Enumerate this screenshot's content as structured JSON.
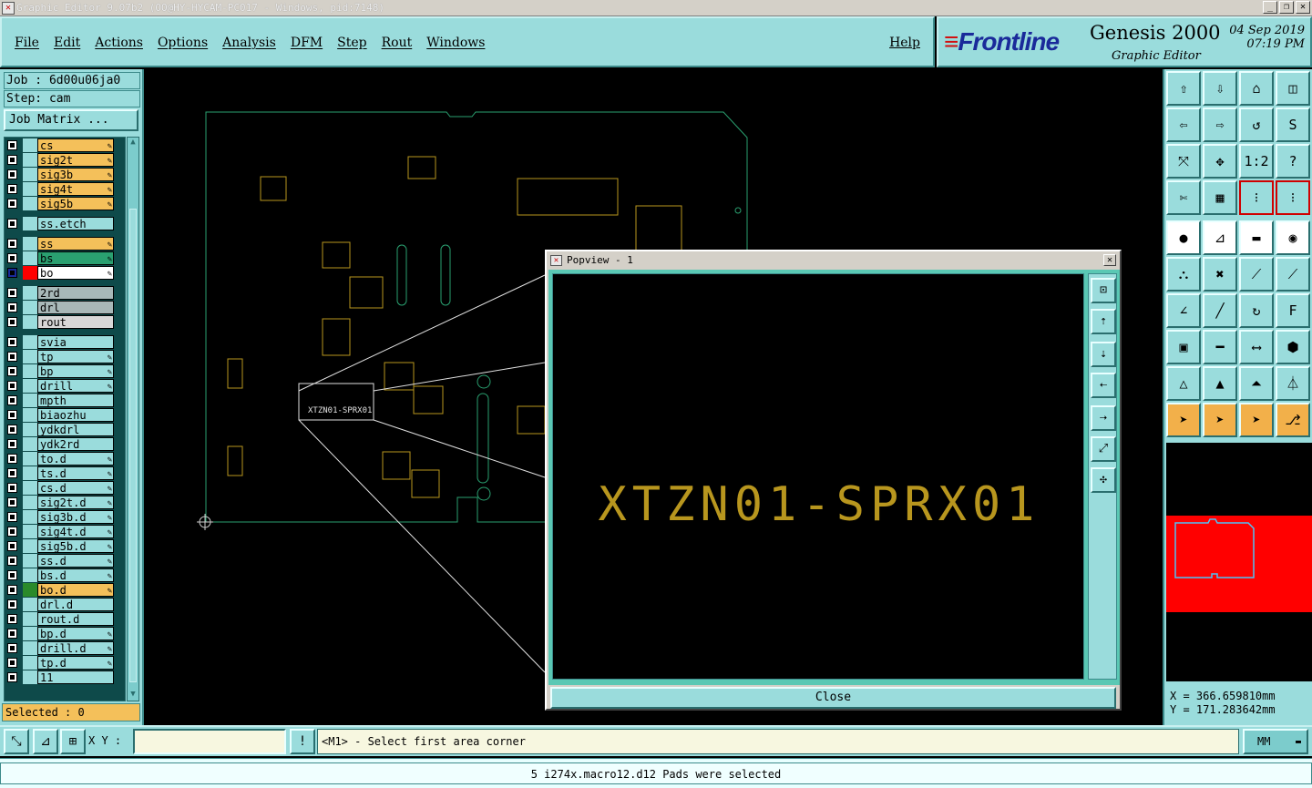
{
  "window": {
    "title": "Graphic Editor 9.07b2 (OO@HY-HYCAM-PC017 - Windows, pid:7148)"
  },
  "menu": {
    "items": [
      "File",
      "Edit",
      "Actions",
      "Options",
      "Analysis",
      "DFM",
      "Step",
      "Rout",
      "Windows"
    ],
    "help": "Help"
  },
  "brand": {
    "logo": "Frontline",
    "product": "Genesis 2000",
    "subtitle": "Graphic Editor",
    "date": "04 Sep 2019",
    "time": "07:19 PM"
  },
  "job": {
    "job_label": "Job : 6d00u06ja0",
    "step_label": "Step: cam",
    "matrix_button": "Job Matrix ..."
  },
  "layers": [
    {
      "name": "cs",
      "color": "#f4c05a",
      "editable": true
    },
    {
      "name": "sig2t",
      "color": "#f4c05a",
      "editable": true
    },
    {
      "name": "sig3b",
      "color": "#f4c05a",
      "editable": true
    },
    {
      "name": "sig4t",
      "color": "#f4c05a",
      "editable": true
    },
    {
      "name": "sig5b",
      "color": "#f4c05a",
      "editable": true
    },
    {
      "name": "ss.etch",
      "color": "#9adcdc",
      "editable": false
    },
    {
      "name": "ss",
      "color": "#f4c05a",
      "editable": true
    },
    {
      "name": "bs",
      "color": "#2aa070",
      "editable": true
    },
    {
      "name": "bo",
      "color": "#ffffff",
      "editable": true
    },
    {
      "name": "2rd",
      "color": "#a8b8b8",
      "editable": false
    },
    {
      "name": "drl",
      "color": "#a8b8b8",
      "editable": false
    },
    {
      "name": "rout",
      "color": "#d8d8d8",
      "editable": false
    },
    {
      "name": "svia",
      "color": "#9adcdc",
      "editable": false
    },
    {
      "name": "tp",
      "color": "#9adcdc",
      "editable": true
    },
    {
      "name": "bp",
      "color": "#9adcdc",
      "editable": true
    },
    {
      "name": "drill",
      "color": "#9adcdc",
      "editable": true
    },
    {
      "name": "mpth",
      "color": "#9adcdc",
      "editable": false
    },
    {
      "name": "biaozhu",
      "color": "#9adcdc",
      "editable": false
    },
    {
      "name": "ydkdrl",
      "color": "#9adcdc",
      "editable": false
    },
    {
      "name": "ydk2rd",
      "color": "#9adcdc",
      "editable": false
    },
    {
      "name": "to.d",
      "color": "#9adcdc",
      "editable": true
    },
    {
      "name": "ts.d",
      "color": "#9adcdc",
      "editable": true
    },
    {
      "name": "cs.d",
      "color": "#9adcdc",
      "editable": true
    },
    {
      "name": "sig2t.d",
      "color": "#9adcdc",
      "editable": true
    },
    {
      "name": "sig3b.d",
      "color": "#9adcdc",
      "editable": true
    },
    {
      "name": "sig4t.d",
      "color": "#9adcdc",
      "editable": true
    },
    {
      "name": "sig5b.d",
      "color": "#9adcdc",
      "editable": true
    },
    {
      "name": "ss.d",
      "color": "#9adcdc",
      "editable": true
    },
    {
      "name": "bs.d",
      "color": "#9adcdc",
      "editable": true
    },
    {
      "name": "bo.d",
      "color": "#f4c05a",
      "editable": true
    },
    {
      "name": "drl.d",
      "color": "#9adcdc",
      "editable": false
    },
    {
      "name": "rout.d",
      "color": "#9adcdc",
      "editable": false
    },
    {
      "name": "bp.d",
      "color": "#9adcdc",
      "editable": true
    },
    {
      "name": "drill.d",
      "color": "#9adcdc",
      "editable": true
    },
    {
      "name": "tp.d",
      "color": "#9adcdc",
      "editable": true
    },
    {
      "name": "11",
      "color": "#9adcdc",
      "editable": false
    }
  ],
  "selected": "Selected : 0",
  "canvas": {
    "zoom_label": "XTZN01-SPRX01",
    "board_color": "#2aa070",
    "component_color": "#b8961e"
  },
  "popview": {
    "title": "Popview - 1",
    "text": "XTZN01-SPRX01",
    "close_button": "Close"
  },
  "coords": {
    "x": "X = 366.659810mm",
    "y": "Y = 171.283642mm"
  },
  "bottom": {
    "xy_label": "X Y :",
    "xy_value": "",
    "prompt": "<M1> - Select first area corner",
    "units": "MM"
  },
  "status": "5 i274x.macro12.d12 Pads were selected"
}
